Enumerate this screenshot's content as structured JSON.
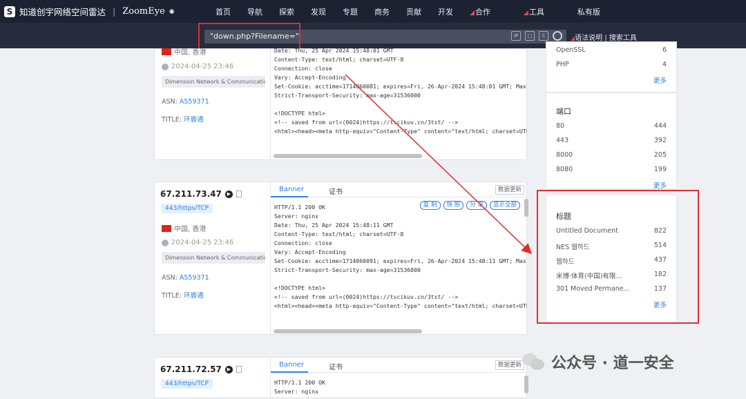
{
  "brand": {
    "name_cn": "知道创宇网络空间雷达",
    "name_en": "ZoomEye"
  },
  "nav": {
    "items": [
      "首页",
      "导航",
      "探索",
      "发现",
      "专题",
      "商务",
      "贡献",
      "开发",
      "合作",
      "工具",
      "私有版"
    ]
  },
  "search": {
    "query": "\"down.php?Filename=\"",
    "syntax_label": "语法说明",
    "tools_label": "搜索工具"
  },
  "cards": [
    {
      "location": "中国, 香港",
      "date": "2024-04-25 23:46",
      "org": "Dimension Network & Communicatio...",
      "asn_label": "ASN:",
      "asn": "AS59371",
      "title_label": "TITLE:",
      "title": "环盾通",
      "banner": "Date: Thu, 25 Apr 2024 15:48:01 GMT\nContent-Type: text/html; charset=UTF-8\nConnection: close\nVary: Accept-Encoding\nSet-Cookie: acctime=1714060081; expires=Fri, 26-Apr-2024 15:48:01 GMT; Max-Age=\nStrict-Transport-Security: max-age=31536000\n\n<!DOCTYPE html>\n<!-- saved from url=(0024)https://tscikuv.cn/3tst/ -->\n<html><head><meta http-equiv=\"Content-Type\" content=\"text/html; charset=UTF-8\">"
    },
    {
      "ip": "67.211.73.47",
      "port": "443/https/TCP",
      "location": "中国, 香港",
      "date": "2024-04-25 23:46",
      "org": "Dimension Network & Communicatio...",
      "asn_label": "ASN:",
      "asn": "AS59371",
      "title_label": "TITLE:",
      "title": "环盾通",
      "tab_banner": "Banner",
      "tab_cert": "证书",
      "refresh": "数据更新",
      "actions": [
        "复 制",
        "快 照",
        "分 享",
        "显示全部"
      ],
      "banner": "HTTP/1.1 200 OK\nServer: nginx\nDate: Thu, 25 Apr 2024 15:48:11 GMT\nContent-Type: text/html; charset=UTF-8\nConnection: close\nVary: Accept-Encoding\nSet-Cookie: acctime=1714060091; expires=Fri, 26-Apr-2024 15:48:11 GMT; Max-Age=\nStrict-Transport-Security: max-age=31536000\n\n<!DOCTYPE html>\n<!-- saved from url=(0024)https://tscikuv.cn/3tst/ -->\n<html><head><meta http-equiv=\"Content-Type\" content=\"text/html; charset=UTF-8\">"
    },
    {
      "ip": "67.211.72.57",
      "port": "443/https/TCP",
      "tab_banner": "Banner",
      "tab_cert": "证书",
      "refresh": "数据更新",
      "banner": "HTTP/1.1 200 OK\nServer: nginx"
    }
  ],
  "sidebar": {
    "components": [
      {
        "name": "OpenSSL",
        "count": "6"
      },
      {
        "name": "PHP",
        "count": "4"
      }
    ],
    "more": "更多",
    "ports_title": "端口",
    "ports": [
      {
        "name": "80",
        "count": "444"
      },
      {
        "name": "443",
        "count": "392"
      },
      {
        "name": "8000",
        "count": "205"
      },
      {
        "name": "8080",
        "count": "199"
      }
    ],
    "titles_title": "标题",
    "titles": [
      {
        "name": "Untitled Document",
        "count": "822"
      },
      {
        "name": "NES 웹하드",
        "count": "514"
      },
      {
        "name": "웹하드",
        "count": "437"
      },
      {
        "name": "米博·体育(中国)有限...",
        "count": "182"
      },
      {
        "name": "301 Moved Permane...",
        "count": "137"
      }
    ]
  },
  "watermark": "公众号 · 道一安全",
  "colors": {
    "topbar": "#1d2233",
    "accent": "#2f7fe6",
    "highlight": "#e02e2e"
  }
}
